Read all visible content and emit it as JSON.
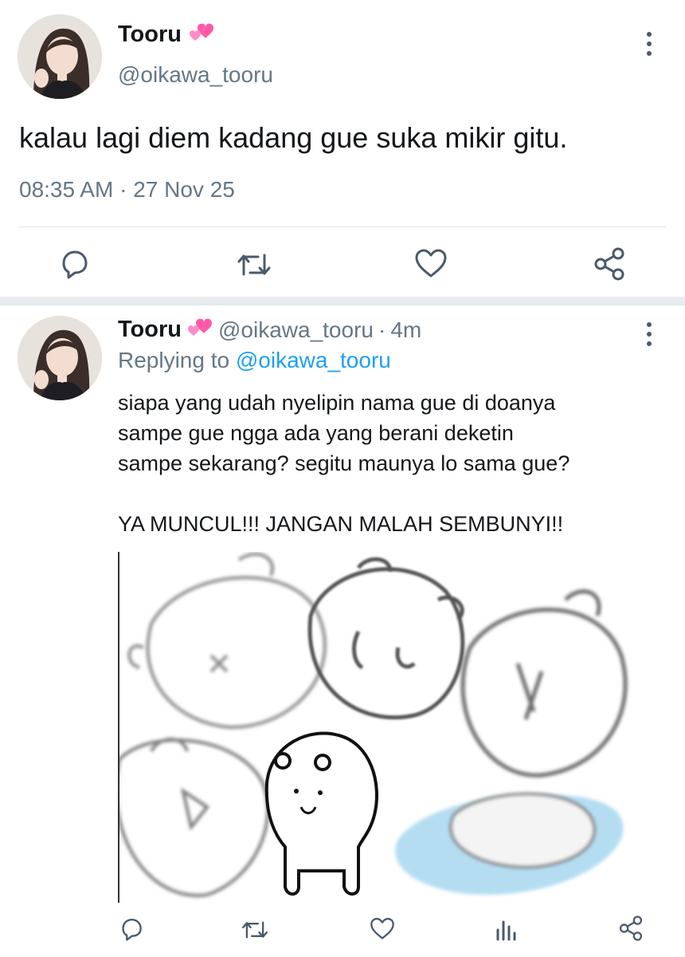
{
  "main_tweet": {
    "display_name": "Tooru",
    "emoji": "💕",
    "handle": "@oikawa_tooru",
    "text": "kalau lagi diem kadang gue suka mikir gitu.",
    "time": "08:35 AM",
    "date_sep": "·",
    "date": "27 Nov 25",
    "actions": [
      "reply-icon",
      "retweet-icon",
      "like-icon",
      "share-icon"
    ]
  },
  "reply_tweet": {
    "display_name": "Tooru",
    "emoji": "💕",
    "handle": "@oikawa_tooru",
    "dot": "·",
    "age": "4m",
    "replying_prefix": "Replying to",
    "replying_handle": "@oikawa_tooru",
    "text": "siapa yang udah nyelipin nama gue di doanya\nsampe gue ngga ada yang berani deketin\nsampe sekarang? segitu maunya lo sama gue?\n\nYA MUNCUL!!! JANGAN MALAH SEMBUNYI!!",
    "media": "meme-image-bears-blur",
    "actions": [
      "reply-icon",
      "retweet-icon",
      "like-icon",
      "analytics-icon",
      "share-icon"
    ]
  },
  "colors": {
    "text": "#14171a",
    "secondary": "#657786",
    "link": "#1da1f2",
    "divider": "#e1e8ed",
    "heart_pink": "#ff5aa8",
    "water_blue": "#a8d8f0"
  }
}
